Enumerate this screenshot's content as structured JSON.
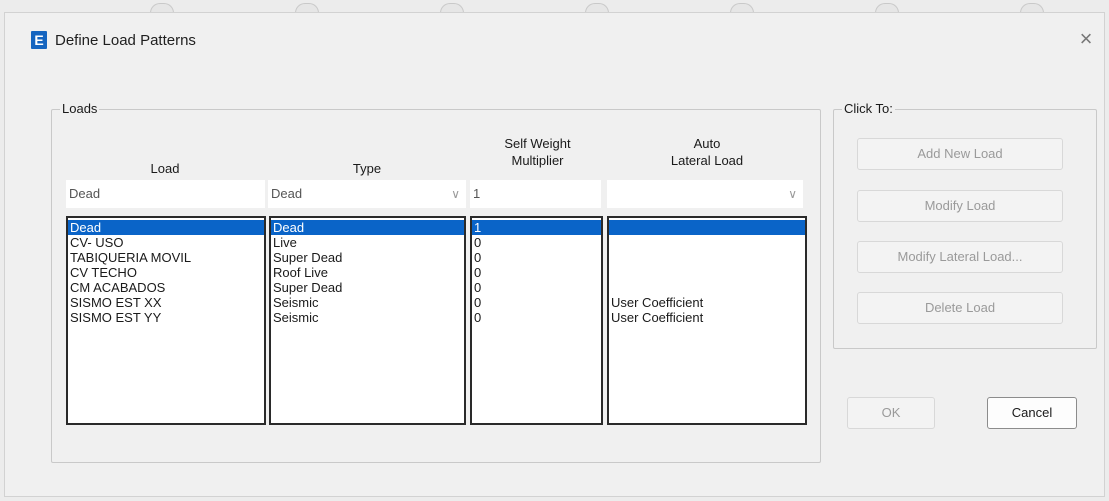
{
  "window": {
    "title": "Define Load Patterns",
    "icon_letter": "E",
    "close_glyph": "×"
  },
  "loads_group": {
    "label": "Loads",
    "headers": {
      "load": "Load",
      "type": "Type",
      "self_weight_1": "Self Weight",
      "self_weight_2": "Multiplier",
      "auto_1": "Auto",
      "auto_2": "Lateral Load"
    },
    "inputs": {
      "load": "Dead",
      "type": "Dead",
      "multiplier": "1",
      "auto_lateral": ""
    },
    "rows": [
      {
        "load": "Dead",
        "type": "Dead",
        "multiplier": "1",
        "auto": ""
      },
      {
        "load": "CV- USO",
        "type": "Live",
        "multiplier": "0",
        "auto": ""
      },
      {
        "load": "TABIQUERIA MOVIL",
        "type": "Super Dead",
        "multiplier": "0",
        "auto": ""
      },
      {
        "load": "CV TECHO",
        "type": "Roof Live",
        "multiplier": "0",
        "auto": ""
      },
      {
        "load": "CM ACABADOS",
        "type": "Super Dead",
        "multiplier": "0",
        "auto": ""
      },
      {
        "load": "SISMO EST XX",
        "type": "Seismic",
        "multiplier": "0",
        "auto": "User Coefficient"
      },
      {
        "load": "SISMO EST YY",
        "type": "Seismic",
        "multiplier": "0",
        "auto": "User Coefficient"
      }
    ]
  },
  "click_group": {
    "label": "Click To:",
    "add_new": "Add New Load",
    "modify": "Modify Load",
    "modify_lateral": "Modify Lateral Load...",
    "delete": "Delete Load"
  },
  "footer": {
    "ok": "OK",
    "cancel": "Cancel"
  },
  "icons": {
    "chevron": "∨"
  },
  "colors": {
    "selection": "#0a64c8",
    "app_icon": "#1565c0"
  }
}
